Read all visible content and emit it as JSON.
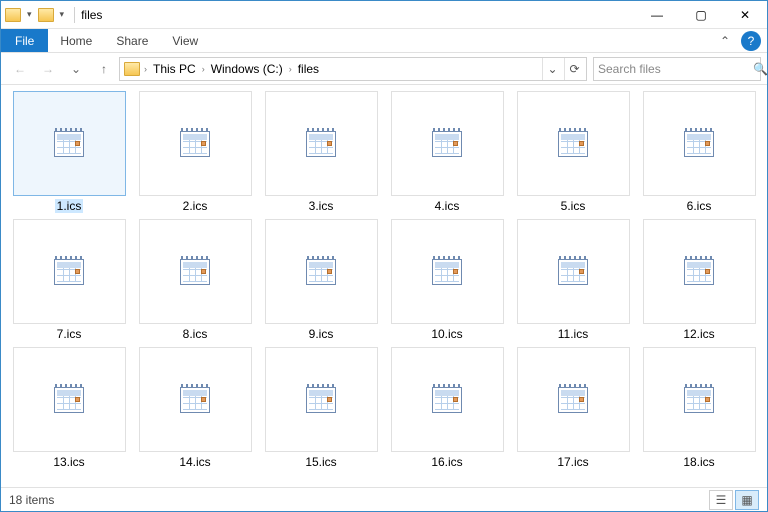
{
  "window": {
    "title": "files"
  },
  "ribbon": {
    "file": "File",
    "tabs": [
      "Home",
      "Share",
      "View"
    ]
  },
  "nav": {
    "back_glyph": "←",
    "forward_glyph": "→",
    "recent_glyph": "⌄",
    "up_glyph": "↑",
    "refresh_glyph": "⟳",
    "dropdown_glyph": "⌄"
  },
  "breadcrumb": [
    "This PC",
    "Windows (C:)",
    "files"
  ],
  "search": {
    "placeholder": "Search files"
  },
  "files": [
    {
      "name": "1.ics",
      "selected": true
    },
    {
      "name": "2.ics"
    },
    {
      "name": "3.ics"
    },
    {
      "name": "4.ics"
    },
    {
      "name": "5.ics"
    },
    {
      "name": "6.ics"
    },
    {
      "name": "7.ics"
    },
    {
      "name": "8.ics"
    },
    {
      "name": "9.ics"
    },
    {
      "name": "10.ics"
    },
    {
      "name": "11.ics"
    },
    {
      "name": "12.ics"
    },
    {
      "name": "13.ics"
    },
    {
      "name": "14.ics"
    },
    {
      "name": "15.ics"
    },
    {
      "name": "16.ics"
    },
    {
      "name": "17.ics"
    },
    {
      "name": "18.ics"
    }
  ],
  "status": {
    "count": "18 items"
  },
  "glyphs": {
    "min": "—",
    "max": "▢",
    "close": "✕",
    "chev": "›",
    "expand": "⌃",
    "help": "?",
    "search": "🔍",
    "details": "☰",
    "thumbs": "▦"
  }
}
